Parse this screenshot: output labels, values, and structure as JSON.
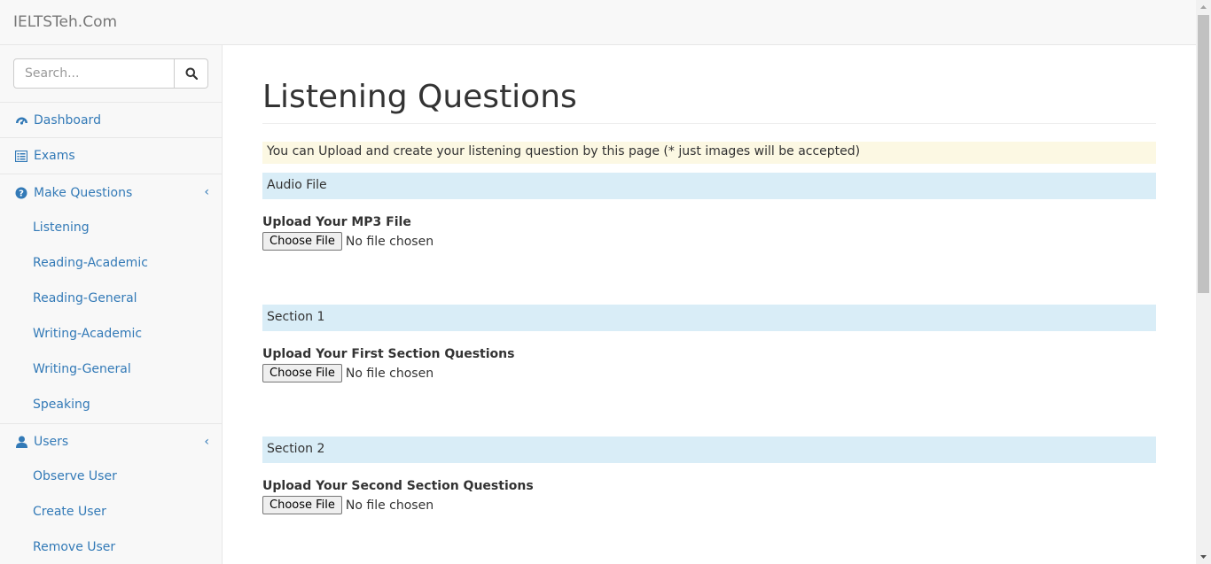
{
  "navbar": {
    "brand": "IELTSTeh.Com"
  },
  "search": {
    "placeholder": "Search..."
  },
  "sidebar": {
    "items": [
      {
        "label": "Dashboard",
        "icon": "dashboard-icon"
      },
      {
        "label": "Exams",
        "icon": "list-icon"
      },
      {
        "label": "Make Questions",
        "icon": "question-circle-icon"
      },
      {
        "label": "Users",
        "icon": "user-icon"
      }
    ],
    "make_questions_sub": [
      "Listening",
      "Reading-Academic",
      "Reading-General",
      "Writing-Academic",
      "Writing-General",
      "Speaking"
    ],
    "users_sub": [
      "Observe User",
      "Create User",
      "Remove User"
    ]
  },
  "main": {
    "title": "Listening Questions",
    "notice": "You can Upload and create your listening question by this page (* just images will be accepted)",
    "sections": [
      {
        "heading": "Audio File",
        "label": "Upload Your MP3 File",
        "button": "Choose File",
        "status": "No file chosen"
      },
      {
        "heading": "Section 1",
        "label": "Upload Your First Section Questions",
        "button": "Choose File",
        "status": "No file chosen"
      },
      {
        "heading": "Section 2",
        "label": "Upload Your Second Section Questions",
        "button": "Choose File",
        "status": "No file chosen"
      }
    ]
  },
  "colors": {
    "link": "#337ab7",
    "notice_bg": "#fcf8e3",
    "section_bg": "#d9edf7"
  }
}
